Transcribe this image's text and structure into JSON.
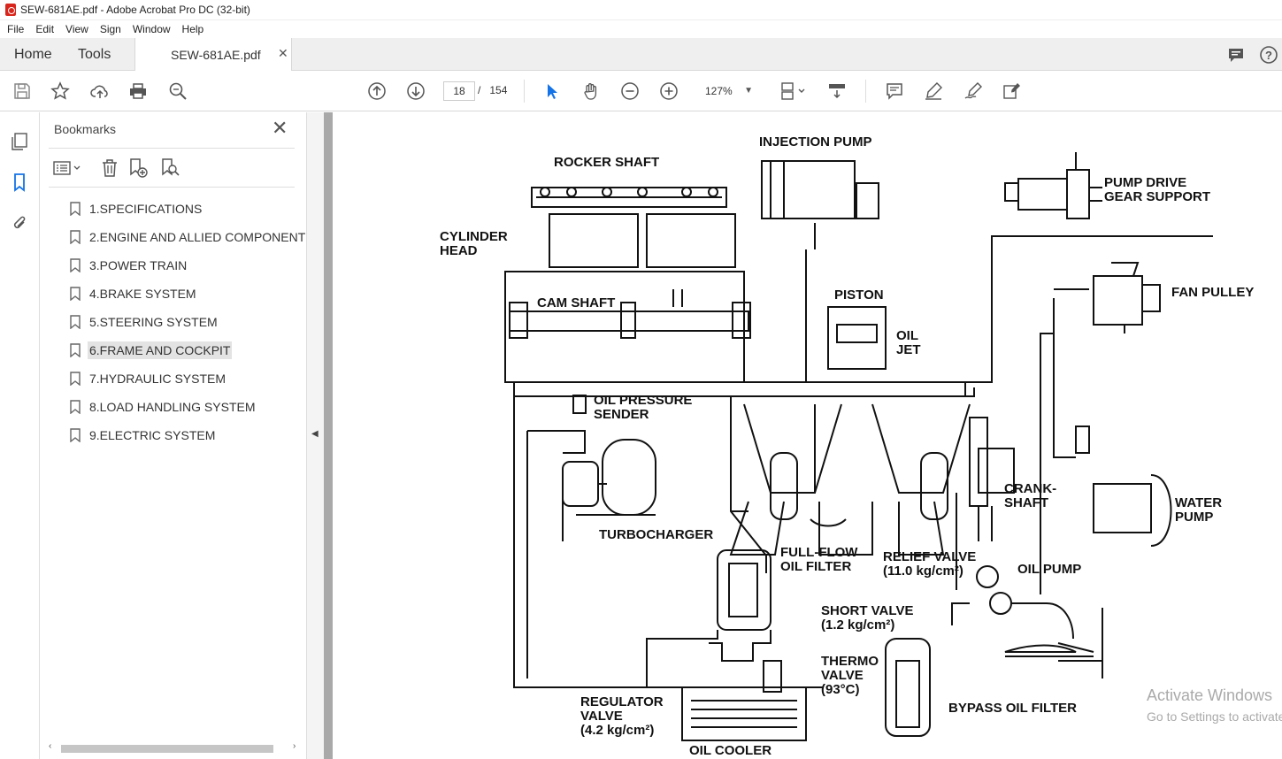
{
  "window": {
    "title": "SEW-681AE.pdf - Adobe Acrobat Pro DC (32-bit)"
  },
  "menu": [
    "File",
    "Edit",
    "View",
    "Sign",
    "Window",
    "Help"
  ],
  "tabs": {
    "home": "Home",
    "tools": "Tools",
    "document": "SEW-681AE.pdf"
  },
  "toolbar": {
    "current_page": "18",
    "page_separator": "/",
    "total_pages": "154",
    "zoom": "127%"
  },
  "bookmarks_panel": {
    "title": "Bookmarks",
    "items": [
      {
        "label": "1.SPECIFICATIONS"
      },
      {
        "label": "2.ENGINE AND ALLIED COMPONENT"
      },
      {
        "label": "3.POWER TRAIN"
      },
      {
        "label": "4.BRAKE SYSTEM"
      },
      {
        "label": "5.STEERING SYSTEM"
      },
      {
        "label": "6.FRAME AND COCKPIT"
      },
      {
        "label": "7.HYDRAULIC SYSTEM"
      },
      {
        "label": "8.LOAD HANDLING SYSTEM"
      },
      {
        "label": "9.ELECTRIC SYSTEM"
      }
    ],
    "selected_index": 5
  },
  "diagram": {
    "labels": {
      "rocker_shaft": "ROCKER SHAFT",
      "injection_pump": "INJECTION PUMP",
      "pump_drive_1": "PUMP DRIVE",
      "pump_drive_2": "GEAR SUPPORT",
      "cylinder_1": "CYLINDER",
      "cylinder_2": "HEAD",
      "fan_pulley": "FAN PULLEY",
      "piston": "PISTON",
      "cam_shaft": "CAM SHAFT",
      "oil_jet_1": "OIL",
      "oil_jet_2": "JET",
      "oil_pressure_1": "OIL PRESSURE",
      "oil_pressure_2": "SENDER",
      "crank_1": "CRANK-",
      "crank_2": "SHAFT",
      "water_pump_1": "WATER",
      "water_pump_2": "PUMP",
      "turbocharger": "TURBOCHARGER",
      "full_flow_1": "FULL-FLOW",
      "full_flow_2": "OIL FILTER",
      "relief_1": "RELIEF VALVE",
      "relief_2": "(11.0 kg/cm²)",
      "oil_pump": "OIL PUMP",
      "short_1": "SHORT VALVE",
      "short_2": "(1.2 kg/cm²)",
      "thermo_1": "THERMO",
      "thermo_2": "VALVE",
      "thermo_3": "(93°C)",
      "regulator_1": "REGULATOR",
      "regulator_2": "VALVE",
      "regulator_3": "(4.2 kg/cm²)",
      "bypass": "BYPASS OIL FILTER",
      "oil_cooler": "OIL COOLER"
    }
  },
  "watermark": {
    "line1": "Activate Windows",
    "line2": "Go to Settings to activate Windows."
  }
}
